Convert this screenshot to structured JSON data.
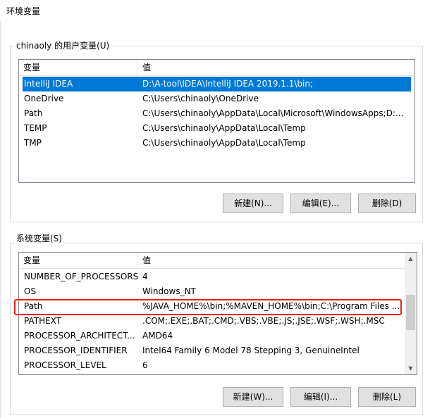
{
  "window": {
    "title": "环境变量"
  },
  "user_vars": {
    "group_label": "chinaoly 的用户变量(U)",
    "columns": [
      "变量",
      "值"
    ],
    "rows": [
      {
        "name": "IntelliJ IDEA",
        "value": "D:\\A-tool\\IDEA\\IntelliJ IDEA 2019.1.1\\bin;"
      },
      {
        "name": "OneDrive",
        "value": "C:\\Users\\chinaoly\\OneDrive"
      },
      {
        "name": "Path",
        "value": "C:\\Users\\chinaoly\\AppData\\Local\\Microsoft\\WindowsApps;D:..."
      },
      {
        "name": "TEMP",
        "value": "C:\\Users\\chinaoly\\AppData\\Local\\Temp"
      },
      {
        "name": "TMP",
        "value": "C:\\Users\\chinaoly\\AppData\\Local\\Temp"
      }
    ],
    "selected_index": 0,
    "buttons": {
      "new": "新建(N)...",
      "edit": "编辑(E)...",
      "delete": "删除(D)"
    }
  },
  "system_vars": {
    "group_label": "系统变量(S)",
    "columns": [
      "变量",
      "值"
    ],
    "rows": [
      {
        "name": "NUMBER_OF_PROCESSORS",
        "value": "4"
      },
      {
        "name": "OS",
        "value": "Windows_NT"
      },
      {
        "name": "Path",
        "value": "%JAVA_HOME%\\bin;%MAVEN_HOME%\\bin;C:\\Program Files ..."
      },
      {
        "name": "PATHEXT",
        "value": ".COM;.EXE;.BAT;.CMD;.VBS;.VBE;.JS;.JSE;.WSF;.WSH;.MSC"
      },
      {
        "name": "PROCESSOR_ARCHITECT...",
        "value": "AMD64"
      },
      {
        "name": "PROCESSOR_IDENTIFIER",
        "value": "Intel64 Family 6 Model 78 Stepping 3, GenuineIntel"
      },
      {
        "name": "PROCESSOR_LEVEL",
        "value": "6"
      }
    ],
    "highlighted_index": 2,
    "buttons": {
      "new": "新建(W)...",
      "edit": "编辑(I)...",
      "delete": "删除(L)"
    }
  },
  "colors": {
    "selection": "#0078d7",
    "highlight_box": "#e8201c"
  }
}
